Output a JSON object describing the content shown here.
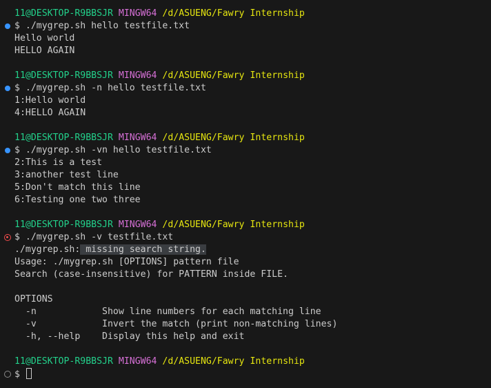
{
  "prompt": {
    "user_host": "11@DESKTOP-R9BBSJR",
    "system": "MINGW64",
    "path": "/d/ASUENG/Fawry Internship"
  },
  "blocks": [
    {
      "status": "success",
      "command": "$ ./mygrep.sh hello testfile.txt",
      "output": [
        "Hello world",
        "HELLO AGAIN"
      ]
    },
    {
      "status": "success",
      "command": "$ ./mygrep.sh -n hello testfile.txt",
      "output": [
        "1:Hello world",
        "4:HELLO AGAIN"
      ]
    },
    {
      "status": "success",
      "command": "$ ./mygrep.sh -vn hello testfile.txt",
      "output": [
        "2:This is a test",
        "3:another test line",
        "5:Don't match this line",
        "6:Testing one two three"
      ]
    },
    {
      "status": "error",
      "command": "$ ./mygrep.sh -v testfile.txt",
      "error_prefix": "./mygrep.sh:",
      "error_highlight": " missing search string.",
      "output": [
        "Usage: ./mygrep.sh [OPTIONS] pattern file",
        "Search (case-insensitive) for PATTERN inside FILE.",
        "",
        "OPTIONS",
        "  -n            Show line numbers for each matching line",
        "  -v            Invert the match (print non-matching lines)",
        "  -h, --help    Display this help and exit"
      ]
    }
  ],
  "current": {
    "status": "pending",
    "command": "$ "
  },
  "colors": {
    "background": "#181818",
    "text": "#cccccc",
    "user_host": "#23d18b",
    "system": "#d670d6",
    "path": "#e5e510",
    "success_marker": "#3794ff",
    "error_marker": "#f14c4c",
    "pending_marker": "#8a8a8a"
  }
}
